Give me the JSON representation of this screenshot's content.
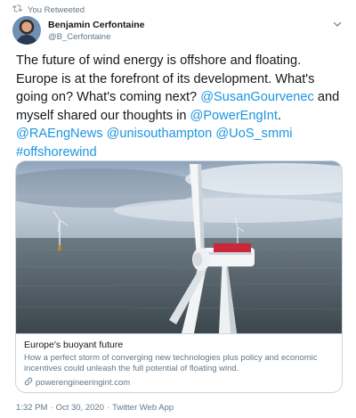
{
  "retweet": {
    "label": "You Retweeted",
    "icon": "retweet-icon"
  },
  "author": {
    "name": "Benjamin Cerfontaine",
    "handle": "@B_Cerfontaine"
  },
  "menu": {
    "icon": "chevron-down-icon"
  },
  "tweet": {
    "text_1": "The future of wind energy is offshore and floating. Europe is at the forefront of its development. What's going on? What's coming next? ",
    "mention_1": "@SusanGourvenec",
    "text_2": " and myself shared our thoughts in ",
    "mention_2": "@PowerEngInt",
    "text_3": ". ",
    "mention_3": "@RAEngNews",
    "mention_4": "@unisouthampton",
    "mention_5": "@UoS_smmi",
    "hashtag_1": "#offshorewind"
  },
  "card": {
    "title": "Europe's buoyant future",
    "description": "How a perfect storm of converging new technologies plus policy and economic incentives could unleash the full potential of floating wind.",
    "domain": "powerengineeringint.com",
    "link_icon": "link-icon"
  },
  "meta": {
    "time": "1:32 PM",
    "date": "Oct 30, 2020",
    "source": "Twitter Web App",
    "separator": "·"
  },
  "colors": {
    "link": "#1b95e0",
    "secondary": "#657786",
    "border": "#ccd6dd",
    "sea": "#4d5a60",
    "sky": "#b9c7d6"
  }
}
